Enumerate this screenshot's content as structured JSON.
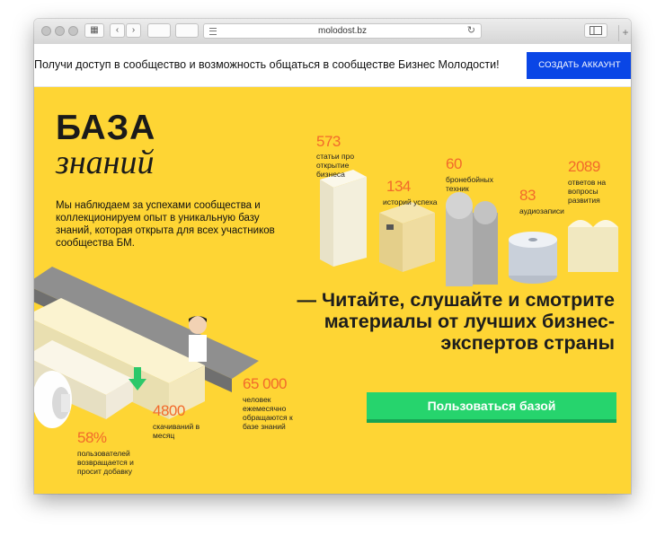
{
  "browser": {
    "url": "molodost.bz"
  },
  "promo": {
    "text": "Получи доступ в сообщество и возможность общаться в сообществе Бизнес Молодости!",
    "button_label": "СОЗДАТЬ АККАУНТ"
  },
  "hero": {
    "title_line1": "БАЗА",
    "title_line2": "знаний",
    "description": "Мы наблюдаем за успехами сообщества и коллекционируем опыт в уникальную базу знаний, которая открыта для всех участников сообщества БМ.",
    "headline": "— Читайте, слушайте и смотрите материалы от лучших бизнес-экспертов страны",
    "cta_label": "Пользоваться базой",
    "stats": [
      {
        "value": "573",
        "label": "статьи про открытие бизнеса"
      },
      {
        "value": "134",
        "label": "историй успеха"
      },
      {
        "value": "60",
        "label": "бронебойных техник"
      },
      {
        "value": "83",
        "label": "аудиозаписи"
      },
      {
        "value": "2089",
        "label": "ответов на вопросы развития"
      },
      {
        "value": "65 000",
        "label": "человек ежемесячно обращаются к базе знаний"
      },
      {
        "value": "4800",
        "label": "скачиваний в месяц"
      },
      {
        "value": "58%",
        "label": "пользователей возвращается и просит добавку"
      }
    ]
  },
  "colors": {
    "hero_bg": "#fed534",
    "accent_number": "#f26a2b",
    "promo_button": "#0a46e6",
    "cta_button": "#26d46d"
  }
}
